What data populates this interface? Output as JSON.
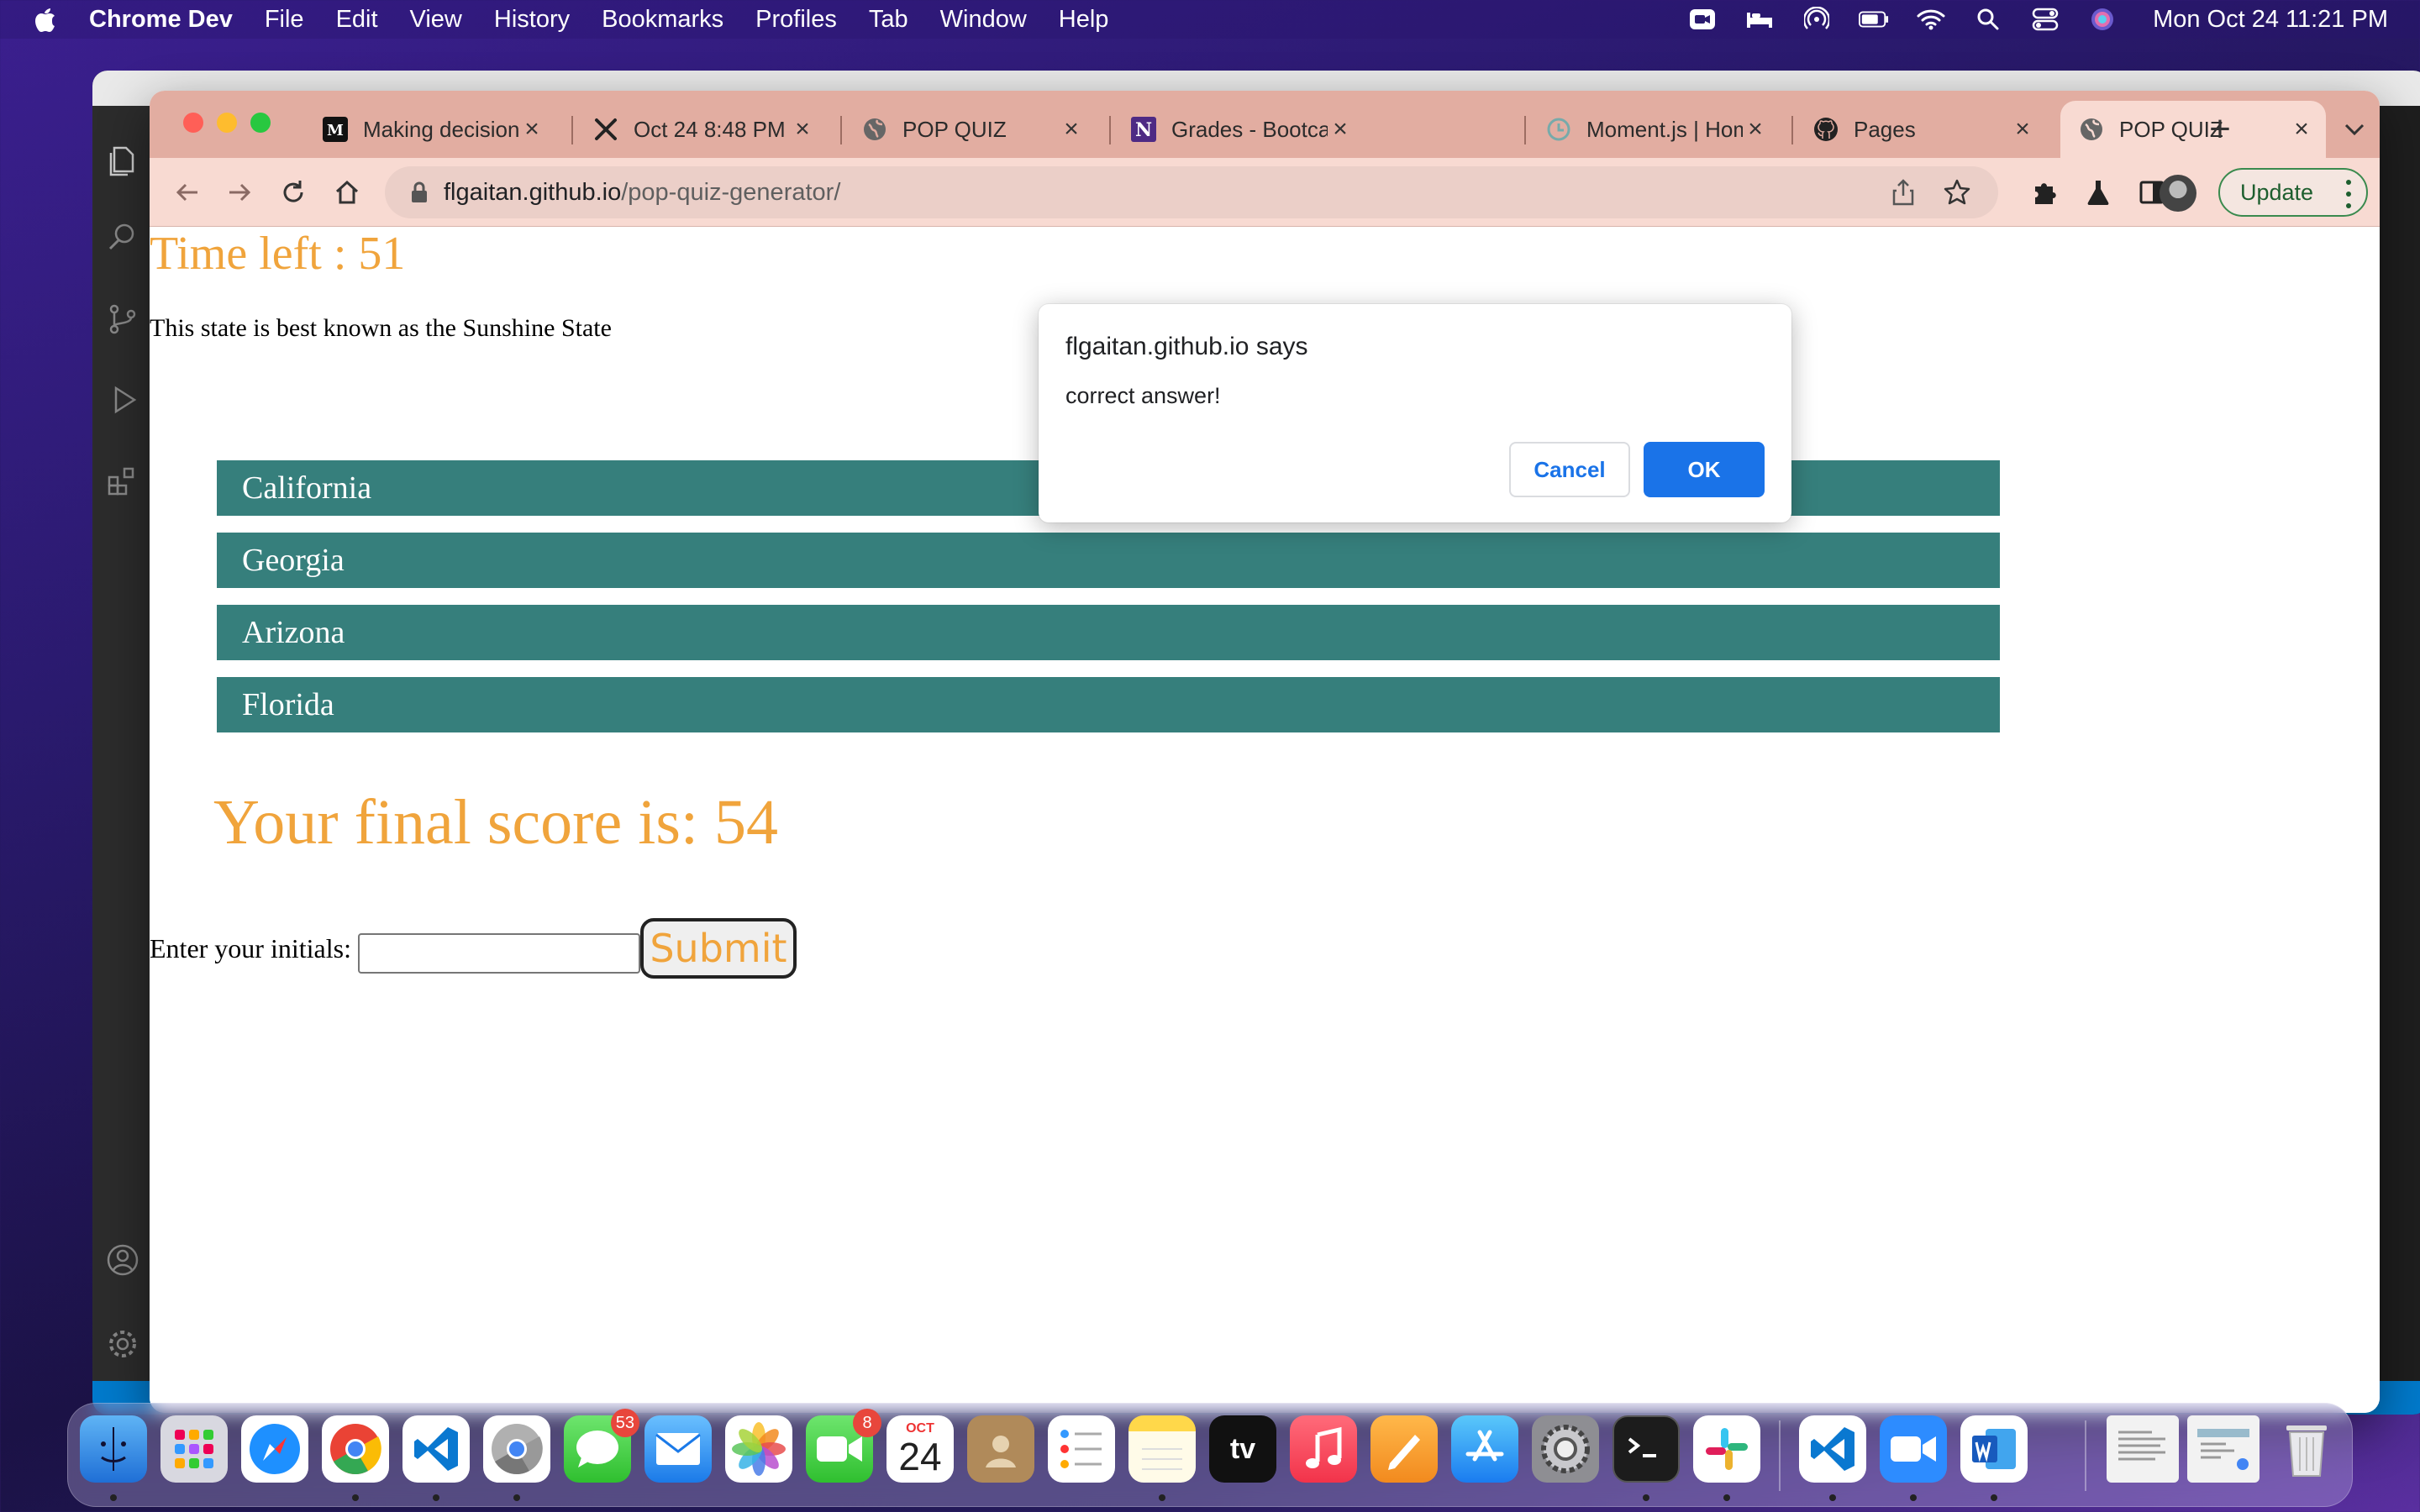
{
  "menubar": {
    "app_name": "Chrome Dev",
    "menus": [
      "File",
      "Edit",
      "View",
      "History",
      "Bookmarks",
      "Profiles",
      "Tab",
      "Window",
      "Help"
    ],
    "clock": "Mon Oct 24  11:21 PM"
  },
  "browser": {
    "tabs": [
      {
        "title": "Making decisions",
        "icon": "medium-icon"
      },
      {
        "title": "Oct 24 8:48 PM",
        "icon": "capcut-icon"
      },
      {
        "title": "POP QUIZ",
        "icon": "globe-icon"
      },
      {
        "title": "Grades - Bootcamp",
        "icon": "n-logo-icon"
      },
      {
        "title": "Moment.js | Home",
        "icon": "clock-icon"
      },
      {
        "title": "Pages",
        "icon": "github-icon"
      },
      {
        "title": "POP QUIZ",
        "icon": "globe-icon",
        "active": true
      }
    ],
    "url_host": "flgaitan.github.io",
    "url_path": "/pop-quiz-generator/",
    "update_label": "Update"
  },
  "page": {
    "timer": "Time left : 51",
    "question": "This state is best known as the Sunshine State",
    "answers": [
      "California",
      "Georgia",
      "Arizona",
      "Florida"
    ],
    "final_score": "Your final score is: 54",
    "initials_label": "Enter your initials:",
    "initials_value": "",
    "submit_label": "Submit",
    "answer_color": "#367f7c",
    "accent_color": "#f0a43c"
  },
  "dialog": {
    "title": "flgaitan.github.io says",
    "message": "correct answer!",
    "cancel_label": "Cancel",
    "ok_label": "OK"
  },
  "dock": {
    "badges": {
      "messages": "53",
      "facetime": "8"
    },
    "calendar_month": "OCT",
    "calendar_day": "24",
    "tv_label": "tv"
  }
}
